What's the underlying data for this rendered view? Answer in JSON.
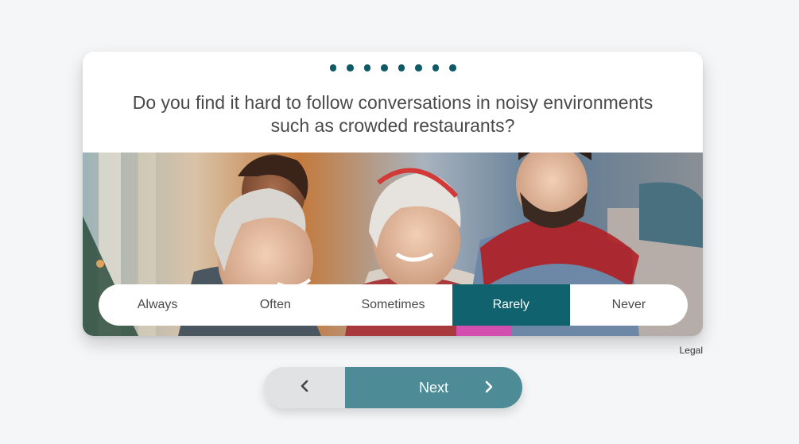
{
  "progress": {
    "total_steps": 8
  },
  "question": {
    "text": "Do you find it hard to follow conversations in noisy environments such as crowded restaurants?"
  },
  "photo": {
    "description_icon": "people-celebrating-photo"
  },
  "answers": {
    "options": [
      {
        "label": "Always",
        "selected": false
      },
      {
        "label": "Often",
        "selected": false
      },
      {
        "label": "Sometimes",
        "selected": false
      },
      {
        "label": "Rarely",
        "selected": true
      },
      {
        "label": "Never",
        "selected": false
      }
    ],
    "selected_color": "#11626f"
  },
  "legal": {
    "label": "Legal"
  },
  "navigation": {
    "back_icon": "chevron-left-icon",
    "next_label": "Next",
    "next_icon": "chevron-right-icon",
    "next_color": "#4d8c97"
  }
}
